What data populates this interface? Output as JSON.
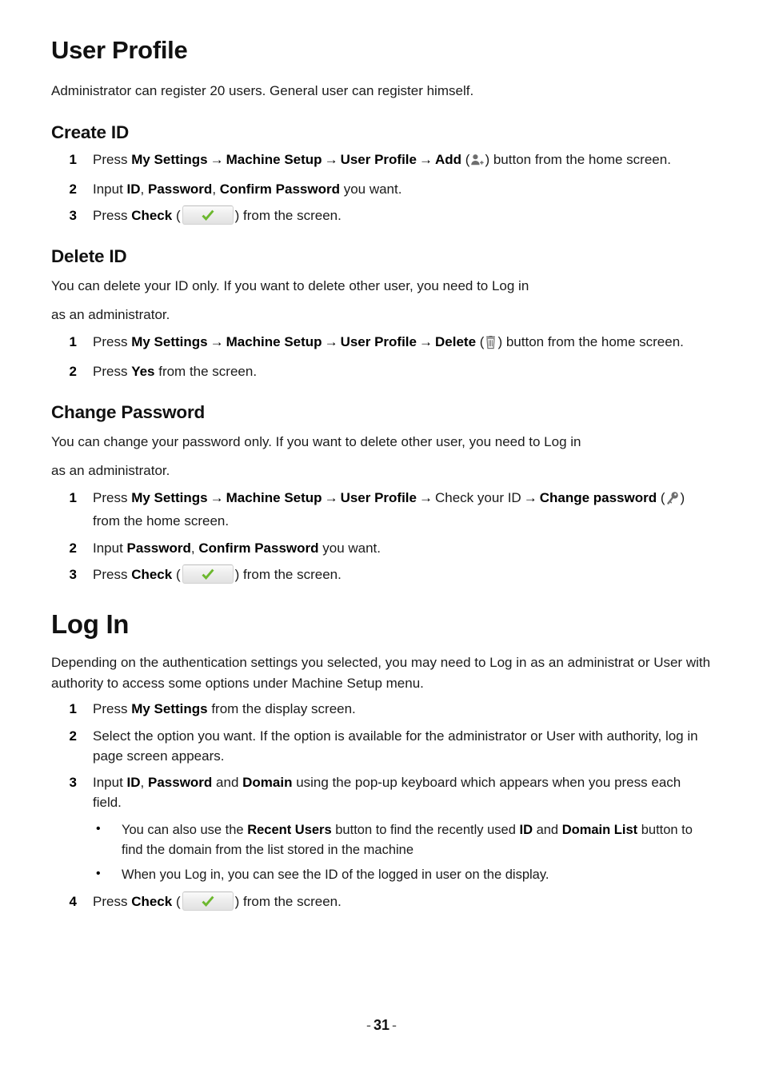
{
  "document": {
    "chapter_title": "User Profile",
    "chapter_intro": "Administrator can register 20 users. General user can register himself.",
    "page_number": "31",
    "page_dash_left": "-",
    "page_dash_right": "-"
  },
  "colors": {
    "check_green": "#6cb82e",
    "icon_gray": "#6e6e6e",
    "text": "#1b1b1b"
  },
  "menu": {
    "my_settings": "My Settings",
    "machine_setup": "Machine Setup",
    "user_profile": "User Profile",
    "add": "Add",
    "delete": "Delete",
    "check": "Check",
    "yes": "Yes",
    "change_password": "Change password",
    "check_your_id": "Check your ID",
    "arrow": "→"
  },
  "icons": {
    "add_user": "add-user-icon",
    "trash": "trash-icon",
    "key": "key-icon",
    "check": "check-icon",
    "bullet": "•"
  },
  "create_id": {
    "heading": "Create ID",
    "steps": [
      {
        "num": "1",
        "pre": "Press ",
        "b1": "My Settings",
        "b2": "Machine Setup",
        "b3": "User Profile",
        "b4": "Add",
        "open_paren": "(",
        "close_paren": ")",
        "post": " button from the home screen."
      },
      {
        "num": "2",
        "pre": "Input ",
        "b1": "ID",
        "sep1": ", ",
        "b2": "Password",
        "sep2": ", ",
        "b3": "Confirm Password",
        "post": " you want."
      },
      {
        "num": "3",
        "pre": "Press ",
        "b1": "Check",
        "open_paren": "(",
        "close_paren": ")",
        "post": " from the screen."
      }
    ]
  },
  "delete_id": {
    "heading": "Delete ID",
    "intro_line1": "You can delete your ID only. If you want to delete other user, you need to Log in",
    "intro_line2": "as an administrator.",
    "steps": [
      {
        "num": "1",
        "pre": "Press ",
        "b1": "My Settings",
        "b2": "Machine Setup",
        "b3": "User Profile",
        "b4": "Delete",
        "open_paren": "(",
        "close_paren": ")",
        "post": " button from the home screen."
      },
      {
        "num": "2",
        "pre": "Press ",
        "b1": "Yes",
        "post": " from the screen."
      }
    ]
  },
  "change_password": {
    "heading": "Change Password",
    "intro_line1": "You can change your password only. If you want to delete other user, you need to Log in",
    "intro_line2": "as an administrator.",
    "steps": [
      {
        "num": "1",
        "pre": "Press ",
        "b1": "My Settings",
        "b2": "Machine Setup",
        "b3": "User Profile",
        "plain4": "Check your ID",
        "b5": "Change password",
        "open_paren": "(",
        "close_paren": ")",
        "post": " from the home screen."
      },
      {
        "num": "2",
        "pre": "Input ",
        "b1": "Password",
        "sep1": ", ",
        "b2": "Confirm Password",
        "post": " you want."
      },
      {
        "num": "3",
        "pre": "Press ",
        "b1": "Check",
        "open_paren": "(",
        "close_paren": ")",
        "post": " from the screen."
      }
    ]
  },
  "log_in": {
    "heading": "Log In",
    "intro": "Depending on the authentication settings you selected, you may need to Log in as an administrat or User with authority to access some options under Machine Setup menu.",
    "steps": [
      {
        "num": "1",
        "pre": "Press ",
        "b1": "My Settings",
        "post": " from the display screen."
      },
      {
        "num": "2",
        "text": "Select the option you want. If the option is available for the administrator or User with authority, log in page screen appears."
      },
      {
        "num": "3",
        "pre": "Input ",
        "b1": "ID",
        "sep1": ", ",
        "b2": "Password",
        "sep2": " and ",
        "b3": "Domain",
        "post": " using the pop-up keyboard which appears when you press each field."
      },
      {
        "num": "4",
        "pre": "Press ",
        "b1": "Check",
        "open_paren": "(",
        "close_paren": ")",
        "post": " from the screen."
      }
    ],
    "bullets": [
      {
        "pre": "You can also use the ",
        "b1": "Recent Users",
        "mid": " button to find the recently used ",
        "b2": "ID",
        "mid2": " and ",
        "b3": "Domain List",
        "post": " button to find the domain from the list stored in the machine"
      },
      {
        "text": "When you Log in, you can see the ID of the logged in user on the display."
      }
    ]
  }
}
